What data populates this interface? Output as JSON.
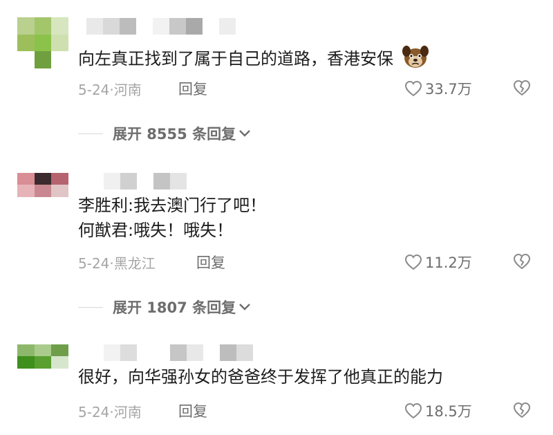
{
  "comments": [
    {
      "lines": [
        "向左真正找到了属于自己的道路，香港安保"
      ],
      "has_emoji": true,
      "emoji_name": "dog-emoji",
      "date_location": "5-24·河南",
      "reply_label": "回复",
      "likes": "33.7万",
      "expand_label": "展开 8555 条回复",
      "avatar_colors": [
        "#b9d08e",
        "#a3c66b",
        "#d7e6be",
        "#9cbf5c",
        "#8bc34a",
        "#cfe0b0",
        "#ffffff",
        "#6f9f3f",
        "#ffffff"
      ],
      "username_colors": [
        "#e9e9e9",
        "#d9d9d9",
        "#bcbcbc",
        "#ffffff",
        "#f2f2f2",
        "#c8c8c8",
        "#a9a9a9",
        "#ffffff",
        "#ededed"
      ]
    },
    {
      "lines": [
        "李胜利:我去澳门行了吧！",
        "何猷君:哦失！哦失！"
      ],
      "has_emoji": false,
      "date_location": "5-24·黑龙江",
      "reply_label": "回复",
      "likes": "11.2万",
      "expand_label": "展开 1807 条回复",
      "avatar_colors": [
        "#d98d95",
        "#3b2a2e",
        "#b5636f",
        "#e6b3b8",
        "#c98891",
        "#e0c4c6",
        "#ffffff",
        "#ffffff",
        "#ffffff"
      ],
      "username_colors": [
        "#f0f0f0",
        "#d0d0d0",
        "#ffffff",
        "#c4c4c4",
        "#e4e4e4"
      ]
    },
    {
      "lines": [
        "很好，向华强孙女的爸爸终于发挥了他真正的能力"
      ],
      "has_emoji": false,
      "date_location": "5-24·河南",
      "reply_label": "回复",
      "likes": "18.5万",
      "avatar_colors": [
        "#8db86b",
        "#a9cc8c",
        "#6e9e4a",
        "#3f8f1c",
        "#5aa030",
        "#d6e6cc",
        "#ffffff",
        "#ffffff",
        "#ffffff"
      ],
      "username_colors": [
        "#f2f2f2",
        "#dddddd",
        "#ffffff",
        "#ffffff",
        "#c6c6c6",
        "#e8e8e8",
        "#ffffff",
        "#bdbdbd",
        "#dcdcdc"
      ]
    }
  ]
}
